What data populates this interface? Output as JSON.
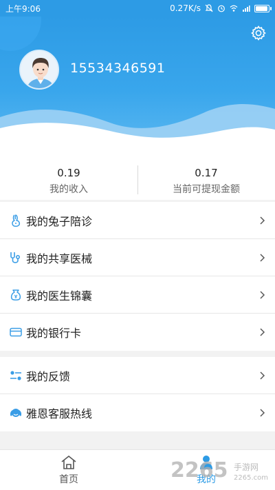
{
  "status_bar": {
    "time": "上午9:06",
    "speed": "0.27K/s"
  },
  "profile": {
    "phone": "15534346591"
  },
  "stats": [
    {
      "value": "0.19",
      "label": "我的收入"
    },
    {
      "value": "0.17",
      "label": "当前可提现金额"
    }
  ],
  "menu_group_1": [
    {
      "label": "我的兔子陪诊",
      "icon": "rabbit-icon"
    },
    {
      "label": "我的共享医械",
      "icon": "stethoscope-icon"
    },
    {
      "label": "我的医生锦囊",
      "icon": "pouch-icon"
    },
    {
      "label": "我的银行卡",
      "icon": "bank-card-icon"
    }
  ],
  "menu_group_2": [
    {
      "label": "我的反馈",
      "icon": "feedback-icon"
    },
    {
      "label": "雅恩客服热线",
      "icon": "headset-icon"
    }
  ],
  "tabs": [
    {
      "label": "首页",
      "icon": "home-icon",
      "active": false
    },
    {
      "label": "我的",
      "icon": "person-icon",
      "active": true
    }
  ],
  "watermark": {
    "text": "2265",
    "suffix": "手游网",
    "url": "2265.com"
  },
  "colors": {
    "accent": "#2d9be5",
    "icon_blue": "#3a9de6"
  }
}
